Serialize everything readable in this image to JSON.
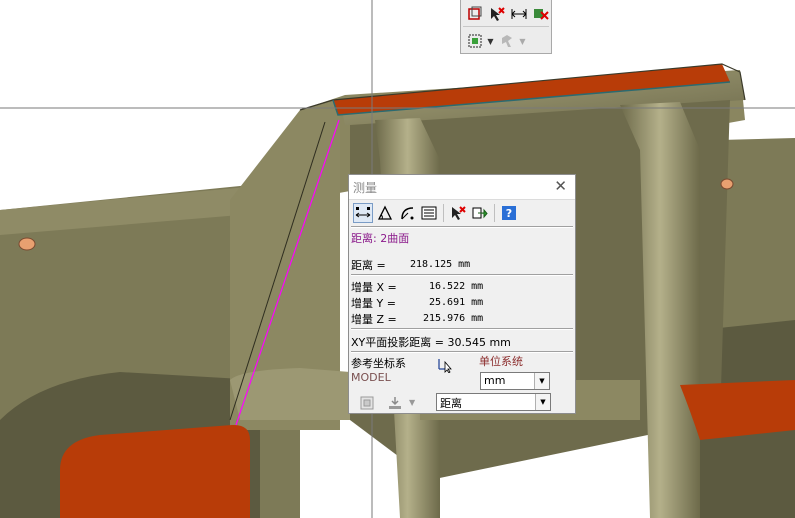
{
  "toolbar": {
    "row1": [
      "box-intersect-icon",
      "clear-selection-icon",
      "measure-distance-icon",
      "clear-measure-icon"
    ],
    "row2": [
      "select-body-icon",
      "pick-filter-icon"
    ]
  },
  "measure": {
    "title": "测量",
    "result_header": "距离: 2曲面",
    "distance_label": "距离 =",
    "distance_value": "218.125 mm",
    "dx_label": "增量 X =",
    "dx_value": "16.522 mm",
    "dy_label": "增量 Y =",
    "dy_value": "25.691 mm",
    "dz_label": "增量 Z =",
    "dz_value": "215.976 mm",
    "xy_projection": "XY平面投影距离 = 30.545 mm",
    "ref_coord_label": "参考坐标系",
    "ref_coord_value": "MODEL",
    "unit_system_label": "单位系统",
    "unit_value": "mm",
    "measure_type_value": "距离",
    "tools": [
      "distance-icon",
      "angle-icon",
      "curvature-icon",
      "info-list-icon",
      "clear-icon",
      "export-icon",
      "help-icon"
    ]
  },
  "colors": {
    "model_body": "#8a8660",
    "model_dark": "#5f5c40",
    "highlight_face": "#b83c08",
    "background": "#6b6a4e"
  }
}
